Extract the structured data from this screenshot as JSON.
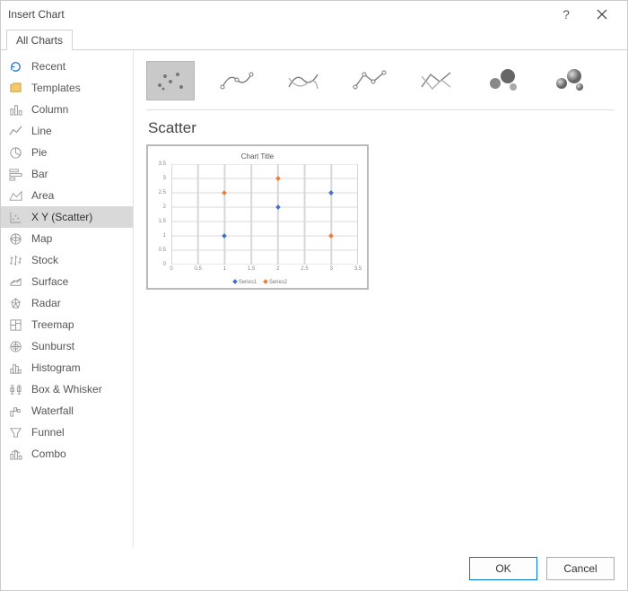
{
  "dialog": {
    "title": "Insert Chart"
  },
  "tabs": {
    "allCharts": "All Charts"
  },
  "categories": [
    {
      "id": "recent",
      "label": "Recent"
    },
    {
      "id": "templates",
      "label": "Templates"
    },
    {
      "id": "column",
      "label": "Column"
    },
    {
      "id": "line",
      "label": "Line"
    },
    {
      "id": "pie",
      "label": "Pie"
    },
    {
      "id": "bar",
      "label": "Bar"
    },
    {
      "id": "area",
      "label": "Area"
    },
    {
      "id": "xyscatter",
      "label": "X Y (Scatter)"
    },
    {
      "id": "map",
      "label": "Map"
    },
    {
      "id": "stock",
      "label": "Stock"
    },
    {
      "id": "surface",
      "label": "Surface"
    },
    {
      "id": "radar",
      "label": "Radar"
    },
    {
      "id": "treemap",
      "label": "Treemap"
    },
    {
      "id": "sunburst",
      "label": "Sunburst"
    },
    {
      "id": "histogram",
      "label": "Histogram"
    },
    {
      "id": "boxwhisker",
      "label": "Box & Whisker"
    },
    {
      "id": "waterfall",
      "label": "Waterfall"
    },
    {
      "id": "funnel",
      "label": "Funnel"
    },
    {
      "id": "combo",
      "label": "Combo"
    }
  ],
  "selectedCategory": "xyscatter",
  "subtypes": [
    {
      "id": "scatter",
      "label": "Scatter"
    },
    {
      "id": "scatter-smooth-markers",
      "label": "Scatter with Smooth Lines and Markers"
    },
    {
      "id": "scatter-smooth",
      "label": "Scatter with Smooth Lines"
    },
    {
      "id": "scatter-straight-markers",
      "label": "Scatter with Straight Lines and Markers"
    },
    {
      "id": "scatter-straight",
      "label": "Scatter with Straight Lines"
    },
    {
      "id": "bubble",
      "label": "Bubble"
    },
    {
      "id": "bubble-3d",
      "label": "3-D Bubble"
    }
  ],
  "selectedSubtype": "scatter",
  "sectionTitle": "Scatter",
  "preview": {
    "title": "Chart Title",
    "legend": {
      "s1": "Series1",
      "s2": "Series2"
    }
  },
  "buttons": {
    "ok": "OK",
    "cancel": "Cancel"
  },
  "chart_data": {
    "type": "scatter",
    "title": "Chart Title",
    "xlabel": "",
    "ylabel": "",
    "xlim": [
      0,
      3.5
    ],
    "ylim": [
      0,
      3.5
    ],
    "x_ticks": [
      0,
      0.5,
      1,
      1.5,
      2,
      2.5,
      3,
      3.5
    ],
    "y_ticks": [
      0,
      0.5,
      1,
      1.5,
      2,
      2.5,
      3,
      3.5
    ],
    "series": [
      {
        "name": "Series1",
        "color": "#4472c4",
        "points": [
          [
            1,
            1
          ],
          [
            2,
            2
          ],
          [
            3,
            2.5
          ]
        ]
      },
      {
        "name": "Series2",
        "color": "#ed7d31",
        "points": [
          [
            1,
            2.5
          ],
          [
            2,
            3
          ],
          [
            3,
            1
          ]
        ]
      }
    ]
  }
}
